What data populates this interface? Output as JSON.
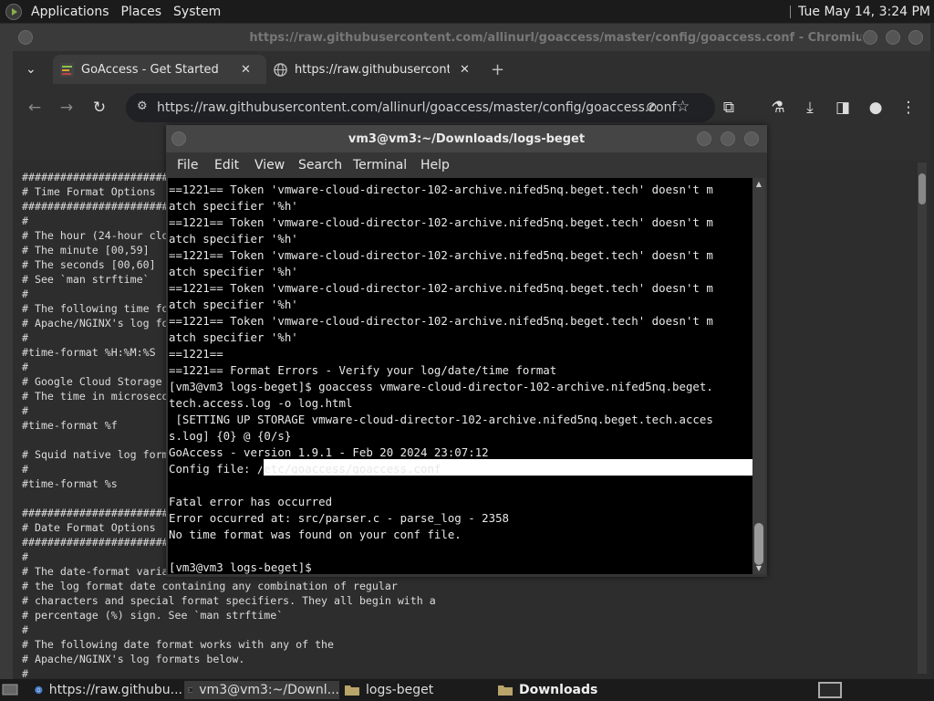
{
  "top_panel": {
    "menu": [
      "Applications",
      "Places",
      "System"
    ],
    "clock": "Tue May 14,  3:24 PM"
  },
  "chrome": {
    "window_title": "https://raw.githubusercontent.com/allinurl/goaccess/master/config/goaccess.conf - Chromium",
    "tabs": [
      {
        "label": "GoAccess - Get Started",
        "close": "✕"
      },
      {
        "label": "https://raw.githubuserconten",
        "close": "✕"
      }
    ],
    "new_tab": "+",
    "tab_list_arrow": "⌄",
    "url": "https://raw.githubusercontent.com/allinurl/goaccess/master/config/goaccess.conf",
    "config_lines": [
      "##################################################",
      "# Time Format Options",
      "##################################################",
      "#",
      "# The hour (24-hour clock)",
      "# The minute [00,59]",
      "# The seconds [00,60]",
      "# See `man strftime`",
      "#",
      "# The following time format works with any of the",
      "# Apache/NGINX's log formats below.",
      "#",
      "#time-format %H:%M:%S",
      "#",
      "# Google Cloud Storage",
      "# The time in microseconds",
      "#",
      "#time-format %f",
      "",
      "# Squid native log format",
      "#",
      "#time-format %s",
      "",
      "##################################################",
      "# Date Format Options",
      "##################################################",
      "#",
      "# The date-format variable",
      "# the log format date containing any combination of regular",
      "# characters and special format specifiers. They all begin with a",
      "# percentage (%) sign. See `man strftime`",
      "#",
      "# The following date format works with any of the",
      "# Apache/NGINX's log formats below.",
      "#"
    ]
  },
  "terminal": {
    "title": "vm3@vm3:~/Downloads/logs-beget",
    "menu": [
      "File",
      "Edit",
      "View",
      "Search",
      "Terminal",
      "Help"
    ],
    "lines": [
      "==1221== Token 'vmware-cloud-director-102-archive.nifed5nq.beget.tech' doesn't m",
      "atch specifier '%h'",
      "==1221== Token 'vmware-cloud-director-102-archive.nifed5nq.beget.tech' doesn't m",
      "atch specifier '%h'",
      "==1221== Token 'vmware-cloud-director-102-archive.nifed5nq.beget.tech' doesn't m",
      "atch specifier '%h'",
      "==1221== Token 'vmware-cloud-director-102-archive.nifed5nq.beget.tech' doesn't m",
      "atch specifier '%h'",
      "==1221== Token 'vmware-cloud-director-102-archive.nifed5nq.beget.tech' doesn't m",
      "atch specifier '%h'",
      "==1221==",
      "==1221== Format Errors - Verify your log/date/time format",
      "[vm3@vm3 logs-beget]$ goaccess vmware-cloud-director-102-archive.nifed5nq.beget.",
      "tech.access.log -o log.html",
      " [SETTING UP STORAGE vmware-cloud-director-102-archive.nifed5nq.beget.tech.acces",
      "s.log] {0} @ {0/s}",
      "GoAccess - version 1.9.1 - Feb 20 2024 23:07:12",
      "Config file: /etc/goaccess/goaccess.conf",
      "",
      "Fatal error has occurred",
      "Error occurred at: src/parser.c - parse_log - 2358",
      "No time format was found on your conf file.",
      "",
      "[vm3@vm3 logs-beget]$"
    ]
  },
  "taskbar": {
    "items": [
      {
        "label": "https://raw.githubu...",
        "icon": "chromium-icon"
      },
      {
        "label": "vm3@vm3:~/Downl...",
        "icon": "terminal-icon"
      },
      {
        "label": "logs-beget",
        "icon": "folder-icon"
      },
      {
        "label": "Downloads",
        "icon": "folder-icon"
      }
    ]
  }
}
